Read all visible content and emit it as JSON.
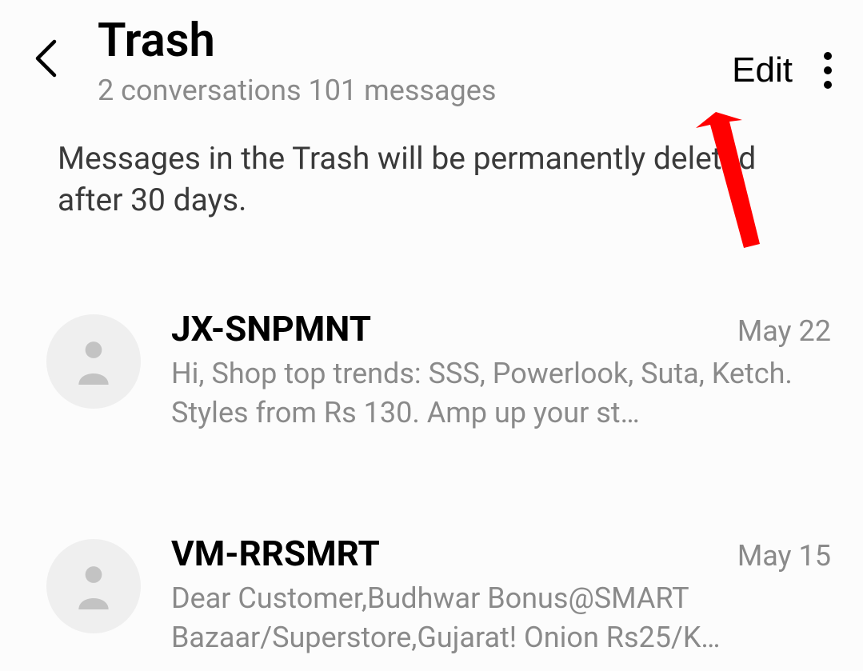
{
  "header": {
    "title": "Trash",
    "subtitle": "2 conversations 101 messages",
    "edit_label": "Edit"
  },
  "notice": "Messages in the Trash will be permanently deleted after 30 days.",
  "conversations": [
    {
      "sender": "JX-SNPMNT",
      "date": "May 22",
      "preview": "Hi, Shop top trends: SSS, Powerlook, Suta, Ketch. Styles from Rs 130. Amp up your st…"
    },
    {
      "sender": "VM-RRSMRT",
      "date": "May 15",
      "preview": "Dear Customer,Budhwar Bonus@SMART Bazaar/Superstore,Gujarat! Onion Rs25/K…"
    }
  ]
}
